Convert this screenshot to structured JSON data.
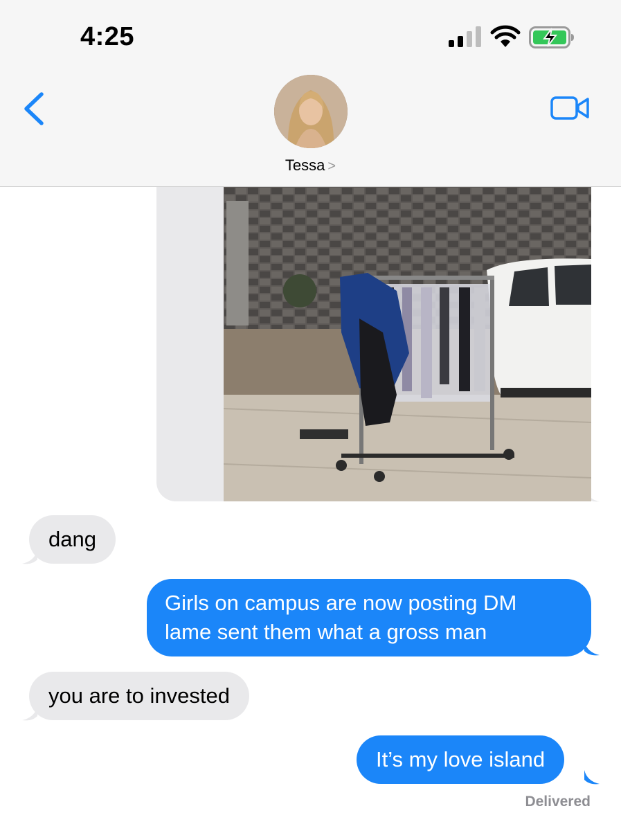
{
  "status_bar": {
    "time": "4:25",
    "icons": [
      "cellular-signal-icon",
      "wifi-icon",
      "battery-charging-icon"
    ],
    "battery_color": "#34c759"
  },
  "header": {
    "contact_name": "Tessa",
    "contact_chevron": ">",
    "back_icon": "chevron-left-icon",
    "video_icon": "facetime-video-icon",
    "accent_color": "#1b86f9"
  },
  "messages": [
    {
      "direction": "incoming",
      "text": "dang"
    },
    {
      "direction": "outgoing",
      "lines": [
        "Girls on campus are now posting DM",
        "lame sent them what a gross man"
      ]
    },
    {
      "direction": "incoming",
      "text": "you are to invested"
    },
    {
      "direction": "outgoing",
      "text": "It’s my love island"
    }
  ],
  "delivery_status": "Delivered",
  "colors": {
    "incoming_bubble": "#e9e9eb",
    "outgoing_bubble": "#1b86f9"
  }
}
